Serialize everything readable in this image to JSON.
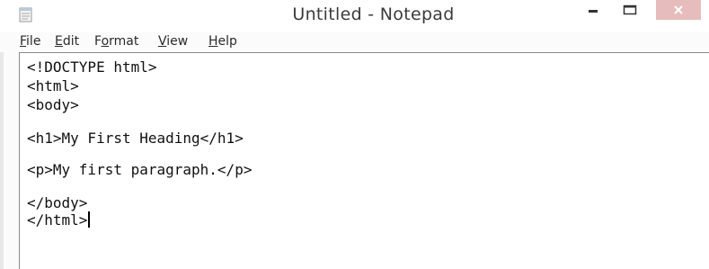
{
  "window": {
    "title": "Untitled - Notepad",
    "app_icon": "notepad-icon",
    "controls": {
      "minimize": "minimize-icon",
      "maximize": "maximize-icon",
      "close": "close-icon"
    }
  },
  "menu": {
    "items": [
      {
        "accel": "F",
        "rest": "ile"
      },
      {
        "accel": "E",
        "rest": "dit"
      },
      {
        "pre": "F",
        "accel": "o",
        "rest": "rmat"
      },
      {
        "accel": "V",
        "rest": "iew"
      },
      {
        "accel": "H",
        "rest": "elp"
      }
    ]
  },
  "editor": {
    "lines": [
      "<!DOCTYPE html>",
      "<html>",
      "<body>",
      "",
      "<h1>My First Heading</h1>",
      "",
      "<p>My first paragraph.</p>",
      "",
      "</body>",
      "</html>"
    ]
  },
  "colors": {
    "close_button": "#e6bcbc",
    "title_text": "#3b3b3b"
  }
}
